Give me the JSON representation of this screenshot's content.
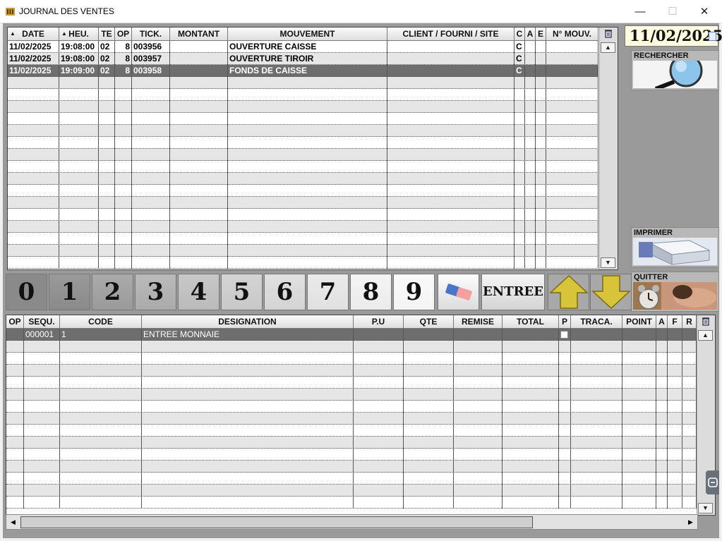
{
  "window": {
    "title": "JOURNAL DES VENTES",
    "min_glyph": "—",
    "max_glyph": "☐",
    "close_glyph": "✕"
  },
  "journal": {
    "headers": [
      "DATE",
      "HEU.",
      "TE",
      "OP",
      "TICK.",
      "MONTANT",
      "MOUVEMENT",
      "CLIENT / FOURNI / SITE",
      "C",
      "A",
      "E",
      "N° MOUV."
    ],
    "rows": [
      [
        "11/02/2025",
        "19:08:00",
        "02",
        "8",
        "003956",
        "",
        "OUVERTURE CAISSE",
        "",
        "C",
        "",
        "",
        ""
      ],
      [
        "11/02/2025",
        "19:08:00",
        "02",
        "8",
        "003957",
        "",
        "OUVERTURE TIROIR",
        "",
        "C",
        "",
        "",
        ""
      ],
      [
        "11/02/2025",
        "19:09:00",
        "02",
        "8",
        "003958",
        "",
        "FONDS DE CAISSE",
        "",
        "C",
        "",
        "",
        ""
      ]
    ],
    "selected_row": 2
  },
  "right_panel": {
    "date": "11/02/2025",
    "search_label": "RECHERCHER",
    "print_label": "IMPRIMER",
    "quit_label": "QUITTER"
  },
  "keypad": {
    "digits": [
      "0",
      "1",
      "2",
      "3",
      "4",
      "5",
      "6",
      "7",
      "8",
      "9"
    ],
    "entree_label": "ENTREE"
  },
  "detail": {
    "headers": [
      "OP",
      "SEQU.",
      "CODE",
      "DESIGNATION",
      "P.U",
      "QTE",
      "REMISE",
      "TOTAL",
      "P",
      "TRACA.",
      "POINT",
      "A",
      "F",
      "R"
    ],
    "rows": [
      [
        "",
        "000001",
        "1",
        "ENTREE MONNAIE",
        "",
        "",
        "",
        "",
        "",
        "",
        "",
        "",
        "",
        ""
      ]
    ]
  },
  "colors": {
    "background": "#9a9a9a",
    "selected_row": "#6e6e6e",
    "date_bg": "#fffce0",
    "arrow_yellow": "#d8c43a"
  }
}
